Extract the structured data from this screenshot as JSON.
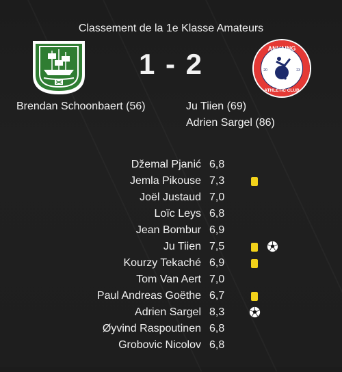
{
  "header": {
    "title": "Classement de la 1e Klasse Amateurs"
  },
  "match": {
    "score": "1 - 2",
    "home_crest_icon": "ship-crest-icon",
    "away_crest_icon": "anvaing-athletic-club-crest-icon",
    "away_crest_text": {
      "top": "ANVAING",
      "bottom": "ATHLETIC CLUB",
      "left_year": "20",
      "right_year": "23"
    }
  },
  "home_scorers": [
    "Brendan Schoonbaert (56)"
  ],
  "away_scorers": [
    "Ju Tiien (69)",
    "Adrien Sargel (86)"
  ],
  "ratings": [
    {
      "name": "Džemal Pjanić",
      "rating": "6,8"
    },
    {
      "name": "Jemla Pikouse",
      "rating": "7,3"
    },
    {
      "name": "Joël Justaud",
      "rating": "7,0"
    },
    {
      "name": "Loïc Leys",
      "rating": "6,8"
    },
    {
      "name": "Jean Bombur",
      "rating": "6,9"
    },
    {
      "name": "Ju Tiien",
      "rating": "7,5"
    },
    {
      "name": "Kourzy Tekaché",
      "rating": "6,9"
    },
    {
      "name": "Tom Van Aert",
      "rating": "7,0"
    },
    {
      "name": "Paul Andreas Goëthe",
      "rating": "6,7"
    },
    {
      "name": "Adrien Sargel",
      "rating": "8,3"
    },
    {
      "name": "Øyvind Raspoutinen",
      "rating": "6,8"
    },
    {
      "name": "Grobovic Nicolov",
      "rating": "6,8"
    }
  ],
  "colors": {
    "yellow_card": "#f2d21a",
    "home_green": "#2f7d32",
    "away_navy": "#1d2a6b",
    "away_red": "#e53935"
  }
}
